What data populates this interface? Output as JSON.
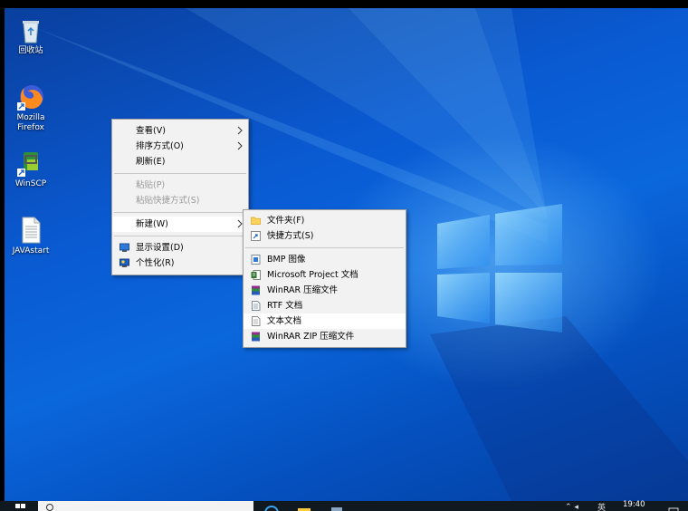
{
  "desktop": {
    "icons": [
      {
        "label": "回收站",
        "icon": "recycle-bin-icon"
      },
      {
        "label": "Mozilla Firefox",
        "line1": "Mozilla",
        "line2": "Firefox",
        "icon": "firefox-icon"
      },
      {
        "label": "WinSCP",
        "icon": "winscp-icon"
      },
      {
        "label": "JAVAstart",
        "icon": "text-file-icon"
      }
    ]
  },
  "context_menu": {
    "items": [
      {
        "label": "查看(V)",
        "submenu": true
      },
      {
        "label": "排序方式(O)",
        "submenu": true
      },
      {
        "label": "刷新(E)"
      },
      {
        "label": "粘贴(P)",
        "disabled": true
      },
      {
        "label": "粘贴快捷方式(S)",
        "disabled": true
      },
      {
        "label": "新建(W)",
        "submenu": true,
        "active": true
      },
      {
        "label": "显示设置(D)",
        "icon": "display-settings-icon"
      },
      {
        "label": "个性化(R)",
        "icon": "personalize-icon"
      }
    ]
  },
  "new_submenu": {
    "items": [
      {
        "label": "文件夹(F)",
        "icon": "folder-icon"
      },
      {
        "label": "快捷方式(S)",
        "icon": "shortcut-icon"
      },
      {
        "label": "BMP 图像",
        "icon": "bmp-icon"
      },
      {
        "label": "Microsoft Project 文档",
        "icon": "project-icon"
      },
      {
        "label": "WinRAR 压缩文件",
        "icon": "winrar-icon"
      },
      {
        "label": "RTF 文档",
        "icon": "rtf-icon"
      },
      {
        "label": "文本文档",
        "icon": "text-document-icon",
        "hovered": true
      },
      {
        "label": "WinRAR ZIP 压缩文件",
        "icon": "winrar-zip-icon"
      }
    ]
  },
  "taskbar": {
    "clock": "19:40",
    "ime": "英"
  },
  "colors": {
    "menu_bg": "#f2f2f2",
    "menu_hover": "#ffffff",
    "desktop_blue": "#0b67dc"
  }
}
